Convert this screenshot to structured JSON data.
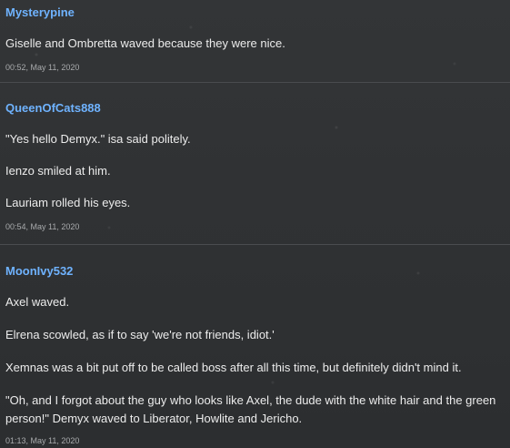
{
  "posts": [
    {
      "author": "Mysterypine",
      "lines": [
        "Giselle and Ombretta waved because they were nice."
      ],
      "timestamp": "00:52, May 11, 2020"
    },
    {
      "author": "QueenOfCats888",
      "lines": [
        "\"Yes hello Demyx.\" isa said politely.",
        "Ienzo smiled at him.",
        "Lauriam rolled his eyes."
      ],
      "timestamp": "00:54, May 11, 2020"
    },
    {
      "author": "MoonIvy532",
      "lines": [
        "Axel waved.",
        "Elrena scowled, as if to say 'we're not friends, idiot.'",
        "Xemnas was a bit put off to be called boss after all this time, but definitely didn't mind it.",
        "\"Oh, and I forgot about the guy who looks like Axel, the dude with the white hair and the green person!\" Demyx waved to Liberator, Howlite and Jericho."
      ],
      "timestamp": "01:13, May 11, 2020"
    }
  ],
  "colors": {
    "background": "#2f3133",
    "author": "#6fb3ff",
    "text": "#ececec",
    "timestamp": "#a9abad",
    "divider": "#4a4c4f"
  }
}
